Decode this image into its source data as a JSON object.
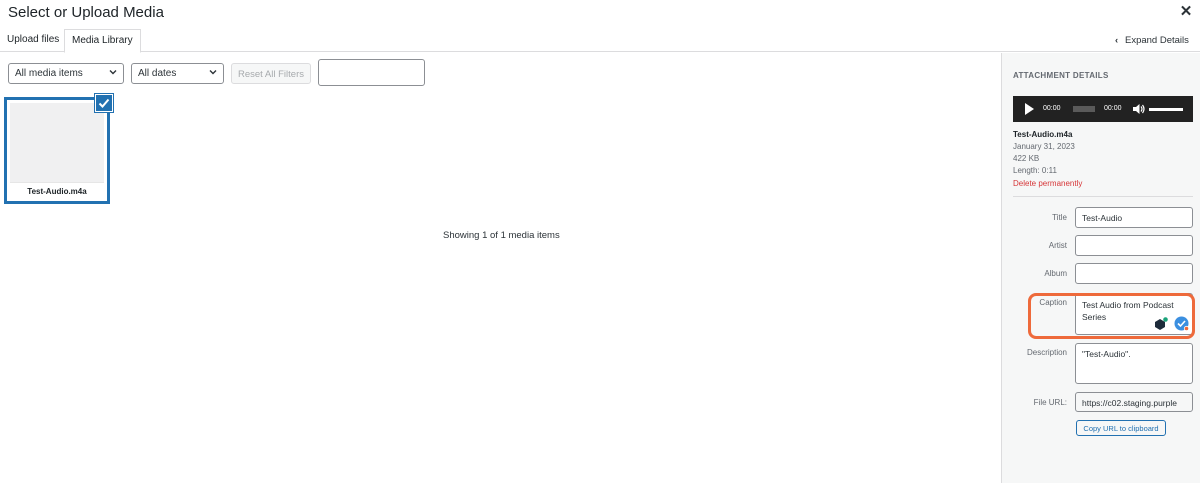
{
  "modal": {
    "title": "Select or Upload Media"
  },
  "tabs": [
    {
      "label": "Upload files"
    },
    {
      "label": "Media Library"
    }
  ],
  "expand_details_label": "Expand Details",
  "filters": {
    "media_type": "All media items",
    "dates": "All dates",
    "reset_label": "Reset All Filters",
    "search_value": ""
  },
  "attachments": [
    {
      "filename": "Test-Audio.m4a",
      "selected": true
    }
  ],
  "status_text": "Showing 1 of 1 media items",
  "details": {
    "header": "ATTACHMENT DETAILS",
    "player": {
      "current_time": "00:00",
      "duration": "00:00"
    },
    "filename": "Test-Audio.m4a",
    "date": "January 31, 2023",
    "size": "422 KB",
    "length": "Length: 0:11",
    "delete_label": "Delete permanently",
    "fields": {
      "title_label": "Title",
      "title_value": "Test-Audio",
      "artist_label": "Artist",
      "artist_value": "",
      "album_label": "Album",
      "album_value": "",
      "caption_label": "Caption",
      "caption_value": "Test Audio from Podcast Series",
      "description_label": "Description",
      "description_value": "\"Test-Audio\".",
      "file_url_label": "File URL:",
      "file_url_value": "https://c02.staging.purple"
    },
    "copy_url_label": "Copy URL to clipboard"
  },
  "colors": {
    "accent": "#2271b1",
    "highlight": "#ee6a3b",
    "danger": "#d63638"
  }
}
